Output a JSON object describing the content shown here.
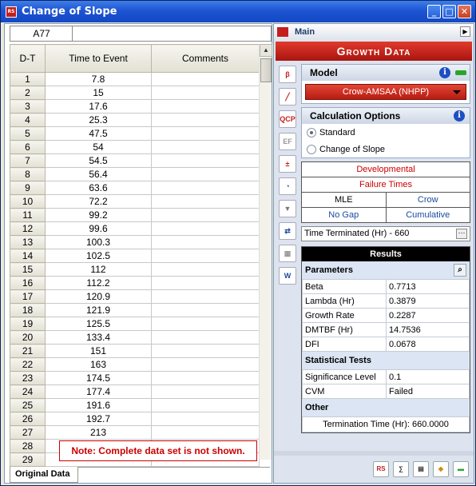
{
  "window": {
    "title": "Change of Slope",
    "app_icon_text": "RS",
    "minimize": "_",
    "maximize": "□",
    "close": "✕"
  },
  "sheet": {
    "cell_ref": "A77",
    "formula_value": "",
    "columns": [
      "D-T",
      "Time to Event",
      "Comments"
    ],
    "rows": [
      [
        "1",
        "7.8",
        ""
      ],
      [
        "2",
        "15",
        ""
      ],
      [
        "3",
        "17.6",
        ""
      ],
      [
        "4",
        "25.3",
        ""
      ],
      [
        "5",
        "47.5",
        ""
      ],
      [
        "6",
        "54",
        ""
      ],
      [
        "7",
        "54.5",
        ""
      ],
      [
        "8",
        "56.4",
        ""
      ],
      [
        "9",
        "63.6",
        ""
      ],
      [
        "10",
        "72.2",
        ""
      ],
      [
        "11",
        "99.2",
        ""
      ],
      [
        "12",
        "99.6",
        ""
      ],
      [
        "13",
        "100.3",
        ""
      ],
      [
        "14",
        "102.5",
        ""
      ],
      [
        "15",
        "112",
        ""
      ],
      [
        "16",
        "112.2",
        ""
      ],
      [
        "17",
        "120.9",
        ""
      ],
      [
        "18",
        "121.9",
        ""
      ],
      [
        "19",
        "125.5",
        ""
      ],
      [
        "20",
        "133.4",
        ""
      ],
      [
        "21",
        "151",
        ""
      ],
      [
        "22",
        "163",
        ""
      ],
      [
        "23",
        "174.5",
        ""
      ],
      [
        "24",
        "177.4",
        ""
      ],
      [
        "25",
        "191.6",
        ""
      ],
      [
        "26",
        "192.7",
        ""
      ],
      [
        "27",
        "213",
        ""
      ],
      [
        "28",
        "",
        ""
      ],
      [
        "29",
        "",
        ""
      ]
    ],
    "note": "Note: Complete data set is not shown.",
    "tab_label": "Original Data"
  },
  "panel": {
    "header_label": "Main",
    "banner": "Growth Data",
    "model_title": "Model",
    "model_value": "Crow-AMSAA (NHPP)",
    "calc_title": "Calculation Options",
    "options": [
      {
        "label": "Standard",
        "selected": true
      },
      {
        "label": "Change of Slope",
        "selected": false
      }
    ],
    "summary": {
      "row1": "Developmental",
      "row2": "Failure Times",
      "method": "MLE",
      "method_value": "Crow",
      "gap": "No Gap",
      "gap_value": "Cumulative"
    },
    "time_terminated": "Time Terminated (Hr) - 660",
    "results": {
      "title": "Results",
      "parameters_title": "Parameters",
      "parameters": [
        {
          "k": "Beta",
          "v": "0.7713"
        },
        {
          "k": "Lambda (Hr)",
          "v": "0.3879"
        },
        {
          "k": "Growth Rate",
          "v": "0.2287"
        },
        {
          "k": "DMTBF (Hr)",
          "v": "14.7536"
        },
        {
          "k": "DFI",
          "v": "0.0678"
        }
      ],
      "stats_title": "Statistical Tests",
      "stats": [
        {
          "k": "Significance Level",
          "v": "0.1"
        },
        {
          "k": "CVM",
          "v": "Failed"
        }
      ],
      "other_title": "Other",
      "termination": "Termination Time (Hr): 660.0000"
    },
    "side_icons": [
      "plot-icon",
      "line-plot-icon",
      "qcp-icon",
      "ef-icon",
      "calc-icon",
      "gauge-icon",
      "filter-icon",
      "transfer-icon",
      "report-icon",
      "web-icon"
    ],
    "bottom_icons": [
      "rs-icon",
      "formula-icon",
      "book-icon",
      "diamond-icon",
      "green-bar-icon"
    ]
  }
}
